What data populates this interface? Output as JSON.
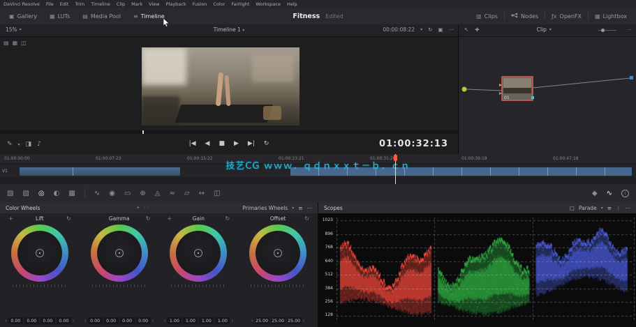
{
  "menu_bar": {
    "items": [
      "DaVinci Resolve",
      "File",
      "Edit",
      "Trim",
      "Timeline",
      "Clip",
      "Mark",
      "View",
      "Playback",
      "Fusion",
      "Color",
      "Fairlight",
      "Workspace",
      "Help"
    ]
  },
  "toolbar": {
    "gallery": "Gallery",
    "luts": "LUTs",
    "media_pool": "Media Pool",
    "timeline": "Timeline",
    "title": "Fitness",
    "status": "Edited",
    "clips": "Clips",
    "nodes": "Nodes",
    "openfx": "OpenFX",
    "lightbox": "Lightbox"
  },
  "viewer": {
    "zoom": "15%",
    "timeline_name": "Timeline 1",
    "clip_timecode": "00:00:08:22",
    "master_timecode": "01:00:32:13"
  },
  "node_panel": {
    "mode": "Clip",
    "node_label": "01"
  },
  "timeline": {
    "track_label": "V1",
    "watermark": "技艺CG ｗｗｗ．ｑｄｎｘｘｔ－ｂ．ｃｎ",
    "ruler": [
      "01:00:00:00",
      "01:00:07:23",
      "01:00:15:22",
      "01:00:23:21",
      "01:00:31:20",
      "01:00:39:19",
      "01:00:47:18"
    ]
  },
  "color_wheels": {
    "title": "Color Wheels",
    "mode": "Primaries Wheels",
    "wheels": [
      {
        "name": "Lift",
        "values": [
          "0.00",
          "0.00",
          "0.00",
          "0.00"
        ]
      },
      {
        "name": "Gamma",
        "values": [
          "0.00",
          "0.00",
          "0.00",
          "0.00"
        ]
      },
      {
        "name": "Gain",
        "values": [
          "1.00",
          "1.00",
          "1.00",
          "1.00"
        ]
      },
      {
        "name": "Offset",
        "values": [
          "25.00",
          "25.00",
          "25.00"
        ]
      }
    ]
  },
  "scopes": {
    "title": "Scopes",
    "mode": "Parade",
    "axis": [
      "1023",
      "896",
      "768",
      "640",
      "512",
      "384",
      "256",
      "128"
    ],
    "channel_colors": [
      "#ff4a3c",
      "#3ad04e",
      "#5a6cff"
    ]
  }
}
